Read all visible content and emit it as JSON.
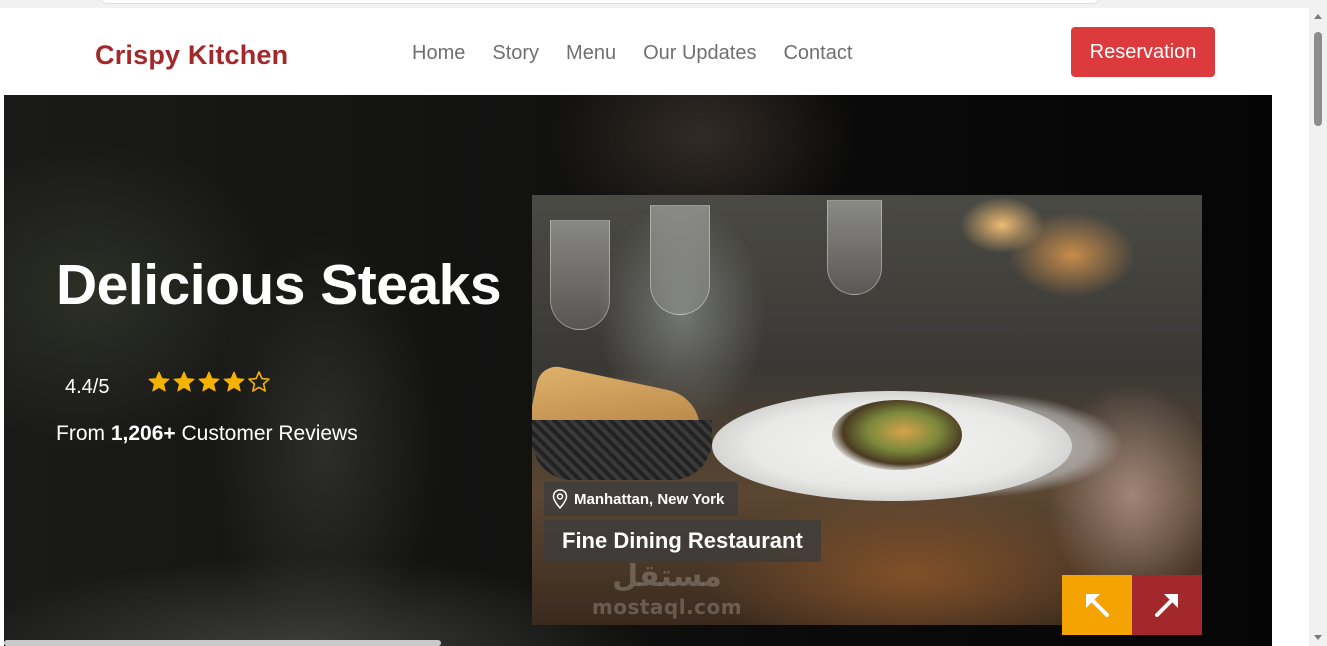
{
  "brand": {
    "name": "Crispy Kitchen",
    "color": "#a3282b"
  },
  "nav": {
    "links": [
      "Home",
      "Story",
      "Menu",
      "Our Updates",
      "Contact"
    ],
    "reservation_label": "Reservation",
    "reservation_color": "#dc3a3d"
  },
  "hero": {
    "title": "Delicious Steaks",
    "rating": "4.4/5",
    "stars": {
      "filled": 4,
      "total": 5,
      "color": "#f5b301"
    },
    "reviews_prefix": "From ",
    "reviews_count": "1,206+",
    "reviews_suffix": " Customer Reviews"
  },
  "feature": {
    "location": "Manhattan, New York",
    "location_icon": "map-pin-icon",
    "restaurant": "Fine Dining Restaurant",
    "watermark_ar": "مستقل",
    "watermark_en": "mostaql.com",
    "prev_icon": "arrow-up-left-icon",
    "next_icon": "arrow-up-right-icon",
    "prev_color": "#f5a300",
    "next_color": "#a3282b"
  }
}
